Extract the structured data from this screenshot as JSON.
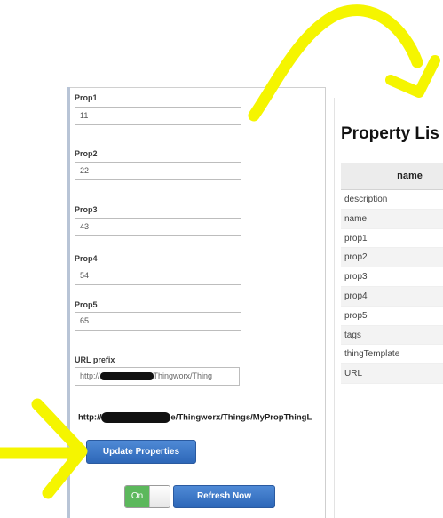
{
  "form": {
    "fields": [
      {
        "label": "Prop1",
        "value": "11"
      },
      {
        "label": "Prop2",
        "value": "22"
      },
      {
        "label": "Prop3",
        "value": "43"
      },
      {
        "label": "Prop4",
        "value": "54"
      },
      {
        "label": "Prop5",
        "value": "65"
      }
    ],
    "url_prefix_label": "URL prefix",
    "url_prefix_start": "http://",
    "url_prefix_end": "Thingworx/Thing",
    "url_text_start": "http://",
    "url_text_end": "e/Thingworx/Things/MyPropThingL"
  },
  "buttons": {
    "update_label": "Update Properties",
    "toggle_label": "On",
    "refresh_label": "Refresh Now"
  },
  "property_list": {
    "title": "Property Lis",
    "column_header": "name",
    "rows": [
      "description",
      "name",
      "prop1",
      "prop2",
      "prop3",
      "prop4",
      "prop5",
      "tags",
      "thingTemplate",
      "URL"
    ]
  },
  "colors": {
    "highlight": "#f5f500",
    "button_blue": "#2d67b8",
    "toggle_green": "#5cb85c"
  }
}
